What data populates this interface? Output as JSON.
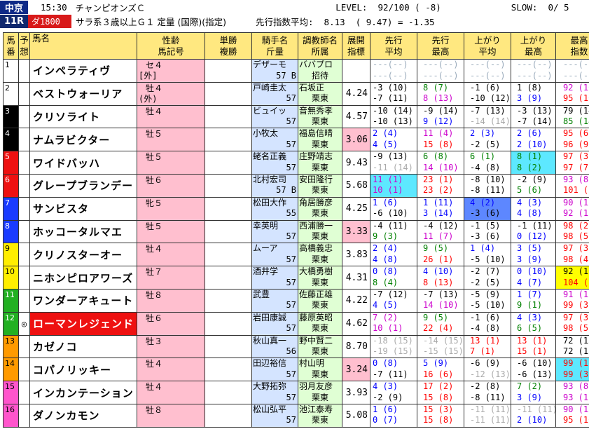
{
  "header": {
    "venue": "中京",
    "race_no": "11R",
    "time": "15:30",
    "race_name": "チャンピオンズＣ",
    "course": "ダ1800",
    "conditions": "サラ系３歳以上Ｇ１ 定量 (国際)(指定)",
    "level": "LEVEL:  92/100 ( -8)",
    "slow": "SLOW:  0/ 5",
    "pace_avg": "先行指数平均:  8.13  ( 9.47) = -1.35"
  },
  "columns": [
    "馬\n番",
    "予\n想",
    "馬名",
    "性齢\n馬記号",
    "単勝\n複勝",
    "騎手名\n斤量",
    "調教師名\n所属",
    "展開\n指標",
    "先行\n平均",
    "先行\n最高",
    "上がり\n平均",
    "上がり\n最高",
    "最高\n指数"
  ],
  "horses": [
    {
      "num": "1",
      "color": "white",
      "mark": "",
      "name": "インペラティヴ",
      "hl": false,
      "sex": "セ４",
      "sex2": "[外]",
      "jockey": "デザーモ",
      "weight": "57 B",
      "trainer": "ババプロ",
      "trainer2": "招待",
      "tenkai": "",
      "tenkai_hi": false,
      "s1": [
        "---(--)",
        "---(--)"
      ],
      "s1c": [
        "dash",
        "dash"
      ],
      "s1bg": "",
      "s2": [
        "---(--)",
        "---(--)"
      ],
      "s2c": [
        "dash",
        "dash"
      ],
      "a1": [
        "---(--)",
        "---(--)"
      ],
      "a1c": [
        "dash",
        "dash"
      ],
      "a1bg": "",
      "a2": [
        "---(--)",
        "---(--)"
      ],
      "a2c": [
        "dash",
        "dash"
      ],
      "a2bg": "",
      "mx": [
        "---(--)",
        "---(--)"
      ],
      "mxc": [
        "dash",
        "dash"
      ],
      "mxbg": ""
    },
    {
      "num": "2",
      "color": "white",
      "mark": "",
      "name": "ベストウォーリア",
      "hl": false,
      "sex": "牡４",
      "sex2": "(外)",
      "jockey": "戸崎圭太",
      "weight": "57",
      "trainer": "石坂正",
      "trainer2": "栗東",
      "tenkai": "4.24",
      "tenkai_hi": false,
      "s1": [
        "-3 (10)",
        "-7 (11)"
      ],
      "s1c": [
        "black",
        "black"
      ],
      "s1bg": "",
      "s2": [
        "8 (7)",
        "8 (13)"
      ],
      "s2c": [
        "green",
        "magenta"
      ],
      "a1": [
        "-1 (6)",
        "-10 (12)"
      ],
      "a1c": [
        "black",
        "black"
      ],
      "a1bg": "",
      "a2": [
        "1 (8)",
        "3 (9)"
      ],
      "a2c": [
        "black",
        "blue"
      ],
      "a2bg": "",
      "mx": [
        "92 (10)",
        "95 (10)"
      ],
      "mxc": [
        "magenta",
        "red"
      ],
      "mxbg": ""
    },
    {
      "num": "3",
      "color": "black",
      "mark": "",
      "name": "クリソライト",
      "hl": false,
      "sex": "牡４",
      "sex2": "",
      "jockey": "ビュイッ",
      "weight": "57",
      "trainer": "音無秀孝",
      "trainer2": "栗東",
      "tenkai": "4.57",
      "tenkai_hi": false,
      "s1": [
        "-10 (14)",
        "-10 (13)"
      ],
      "s1c": [
        "black",
        "black"
      ],
      "s1bg": "",
      "s2": [
        "-9 (14)",
        "9 (12)"
      ],
      "s2c": [
        "black",
        "blue"
      ],
      "a1": [
        "-7 (13)",
        "-14 (14)"
      ],
      "a1c": [
        "black",
        "gray"
      ],
      "a1bg": "",
      "a2": [
        "-3 (13)",
        "-7 (14)"
      ],
      "a2c": [
        "black",
        "black"
      ],
      "a2bg": "",
      "mx": [
        "79 (14)",
        "85 (14)"
      ],
      "mxc": [
        "black",
        "green"
      ],
      "mxbg": ""
    },
    {
      "num": "4",
      "color": "black",
      "mark": "",
      "name": "ナムラビクター",
      "hl": false,
      "sex": "牡５",
      "sex2": "",
      "jockey": "小牧太",
      "weight": "57",
      "trainer": "福島信晴",
      "trainer2": "栗東",
      "tenkai": "3.06",
      "tenkai_hi": true,
      "s1": [
        "2 (4)",
        "4 (5)"
      ],
      "s1c": [
        "blue",
        "blue"
      ],
      "s1bg": "",
      "s2": [
        "11 (4)",
        "15 (8)"
      ],
      "s2c": [
        "magenta",
        "red"
      ],
      "a1": [
        "2 (3)",
        "-2 (5)"
      ],
      "a1c": [
        "blue",
        "black"
      ],
      "a1bg": "",
      "a2": [
        "2 (6)",
        "2 (10)"
      ],
      "a2c": [
        "blue",
        "blue"
      ],
      "a2bg": "",
      "mx": [
        "95 (6)",
        "96 (9)"
      ],
      "mxc": [
        "red",
        "red"
      ],
      "mxbg": ""
    },
    {
      "num": "5",
      "color": "red",
      "mark": "",
      "name": "ワイドバッハ",
      "hl": false,
      "sex": "牡５",
      "sex2": "",
      "jockey": "蛯名正義",
      "weight": "57",
      "trainer": "庄野靖志",
      "trainer2": "栗東",
      "tenkai": "9.43",
      "tenkai_hi": false,
      "s1": [
        "-9 (13)",
        "-11 (14)"
      ],
      "s1c": [
        "black",
        "gray"
      ],
      "s1bg": "",
      "s2": [
        "6 (8)",
        "14 (10)"
      ],
      "s2c": [
        "green",
        "magenta"
      ],
      "a1": [
        "6 (1)",
        "-4 (8)"
      ],
      "a1c": [
        "green",
        "black"
      ],
      "a1bg": "",
      "a2": [
        "8 (1)",
        "8 (2)"
      ],
      "a2c": [
        "green",
        "green"
      ],
      "a2bg": "cyan",
      "mx": [
        "97 (3)",
        "97 (7)"
      ],
      "mxc": [
        "red",
        "red"
      ],
      "mxbg": ""
    },
    {
      "num": "6",
      "color": "red",
      "mark": "",
      "name": "グレープブランデー",
      "hl": false,
      "sex": "牡６",
      "sex2": "",
      "jockey": "北村宏司",
      "weight": "57 B",
      "trainer": "安田隆行",
      "trainer2": "栗東",
      "tenkai": "5.68",
      "tenkai_hi": false,
      "s1": [
        "11 (1)",
        "10 (1)"
      ],
      "s1c": [
        "magenta",
        "magenta"
      ],
      "s1bg": "cyan",
      "s2": [
        "23 (1)",
        "23 (2)"
      ],
      "s2c": [
        "red",
        "red"
      ],
      "a1": [
        "-8 (10)",
        "-8 (11)"
      ],
      "a1c": [
        "black",
        "black"
      ],
      "a1bg": "",
      "a2": [
        "-2 (9)",
        "5 (6)"
      ],
      "a2c": [
        "black",
        "green"
      ],
      "a2bg": "",
      "mx": [
        "93 (8)",
        "101 (2)"
      ],
      "mxc": [
        "magenta",
        "red"
      ],
      "mxbg": ""
    },
    {
      "num": "7",
      "color": "blue",
      "mark": "",
      "name": "サンビスタ",
      "hl": false,
      "sex": "牝５",
      "sex2": "",
      "jockey": "松田大作",
      "weight": "55",
      "trainer": "角居勝彦",
      "trainer2": "栗東",
      "tenkai": "4.25",
      "tenkai_hi": false,
      "s1": [
        "1 (6)",
        "-6 (10)"
      ],
      "s1c": [
        "blue",
        "black"
      ],
      "s1bg": "",
      "s2": [
        "1 (11)",
        "3 (14)"
      ],
      "s2c": [
        "blue",
        "blue"
      ],
      "a1": [
        "4 (2)",
        "-3 (6)"
      ],
      "a1c": [
        "blue",
        "black"
      ],
      "a1bg": "blue",
      "a2": [
        "4 (3)",
        "4 (8)"
      ],
      "a2c": [
        "blue",
        "blue"
      ],
      "a2bg": "",
      "mx": [
        "90 (12)",
        "92 (12)"
      ],
      "mxc": [
        "magenta",
        "magenta"
      ],
      "mxbg": ""
    },
    {
      "num": "8",
      "color": "blue",
      "mark": "",
      "name": "ホッコータルマエ",
      "hl": false,
      "sex": "牡５",
      "sex2": "",
      "jockey": "幸英明",
      "weight": "57",
      "trainer": "西浦勝一",
      "trainer2": "栗東",
      "tenkai": "3.33",
      "tenkai_hi": true,
      "s1": [
        "-4 (11)",
        "9 (3)"
      ],
      "s1c": [
        "black",
        "green"
      ],
      "s1bg": "",
      "s2": [
        "-4 (12)",
        "11 (7)"
      ],
      "s2c": [
        "black",
        "magenta"
      ],
      "a1": [
        "-1 (5)",
        "-3 (6)"
      ],
      "a1c": [
        "black",
        "black"
      ],
      "a1bg": "",
      "a2": [
        "-1 (11)",
        "0 (12)"
      ],
      "a2c": [
        "black",
        "blue"
      ],
      "a2bg": "",
      "mx": [
        "98 (2)",
        "98 (5)"
      ],
      "mxc": [
        "red",
        "red"
      ],
      "mxbg": ""
    },
    {
      "num": "9",
      "color": "yellow",
      "mark": "",
      "name": "クリノスターオー",
      "hl": false,
      "sex": "牡４",
      "sex2": "",
      "jockey": "ムーア",
      "weight": "57",
      "trainer": "高橋義忠",
      "trainer2": "栗東",
      "tenkai": "3.83",
      "tenkai_hi": false,
      "s1": [
        "2 (4)",
        "4 (8)"
      ],
      "s1c": [
        "blue",
        "blue"
      ],
      "s1bg": "",
      "s2": [
        "9 (5)",
        "26 (1)"
      ],
      "s2c": [
        "green",
        "red"
      ],
      "a1": [
        "1 (4)",
        "-5 (10)"
      ],
      "a1c": [
        "blue",
        "black"
      ],
      "a1bg": "",
      "a2": [
        "3 (5)",
        "3 (9)"
      ],
      "a2c": [
        "blue",
        "blue"
      ],
      "a2bg": "",
      "mx": [
        "97 (3)",
        "98 (4)"
      ],
      "mxc": [
        "red",
        "red"
      ],
      "mxbg": ""
    },
    {
      "num": "10",
      "color": "yellow",
      "mark": "",
      "name": "ニホンピロアワーズ",
      "hl": false,
      "sex": "牡７",
      "sex2": "",
      "jockey": "酒井学",
      "weight": "57",
      "trainer": "大橋勇樹",
      "trainer2": "栗東",
      "tenkai": "4.31",
      "tenkai_hi": false,
      "s1": [
        "0 (8)",
        "8 (4)"
      ],
      "s1c": [
        "blue",
        "green"
      ],
      "s1bg": "",
      "s2": [
        "4 (10)",
        "8 (13)"
      ],
      "s2c": [
        "blue",
        "red"
      ],
      "a1": [
        "-2 (7)",
        "-2 (5)"
      ],
      "a1c": [
        "black",
        "black"
      ],
      "a1bg": "",
      "a2": [
        "0 (10)",
        "4 (7)"
      ],
      "a2c": [
        "blue",
        "blue"
      ],
      "a2bg": "",
      "mx": [
        "92 (10)",
        "104 (1)"
      ],
      "mxc": [
        "black",
        "red"
      ],
      "mxbg": "yel"
    },
    {
      "num": "11",
      "color": "green",
      "mark": "",
      "name": "ワンダーアキュート",
      "hl": false,
      "sex": "牡８",
      "sex2": "",
      "jockey": "武豊",
      "weight": "57",
      "trainer": "佐藤正雄",
      "trainer2": "栗東",
      "tenkai": "4.22",
      "tenkai_hi": false,
      "s1": [
        "-7 (12)",
        "4 (5)"
      ],
      "s1c": [
        "black",
        "blue"
      ],
      "s1bg": "",
      "s2": [
        "-7 (13)",
        "14 (10)"
      ],
      "s2c": [
        "black",
        "magenta"
      ],
      "a1": [
        "-5 (9)",
        "-5 (10)"
      ],
      "a1c": [
        "black",
        "black"
      ],
      "a1bg": "",
      "a2": [
        "1 (7)",
        "9 (1)"
      ],
      "a2c": [
        "blue",
        "green"
      ],
      "a2bg": "",
      "mx": [
        "91 (11)",
        "99 (3)"
      ],
      "mxc": [
        "magenta",
        "red"
      ],
      "mxbg": ""
    },
    {
      "num": "12",
      "color": "green",
      "mark": "◎",
      "name": "ローマンレジェンド",
      "hl": true,
      "sex": "牡６",
      "sex2": "",
      "jockey": "岩田康誠",
      "weight": "57",
      "trainer": "藤原英昭",
      "trainer2": "栗東",
      "tenkai": "4.62",
      "tenkai_hi": false,
      "s1": [
        "7 (2)",
        "10 (1)"
      ],
      "s1c": [
        "magenta",
        "magenta"
      ],
      "s1bg": "",
      "s2": [
        "9 (5)",
        "22 (4)"
      ],
      "s2c": [
        "green",
        "red"
      ],
      "a1": [
        "-1 (6)",
        "-4 (8)"
      ],
      "a1c": [
        "black",
        "black"
      ],
      "a1bg": "",
      "a2": [
        "4 (3)",
        "6 (5)"
      ],
      "a2c": [
        "blue",
        "green"
      ],
      "a2bg": "",
      "mx": [
        "97 (3)",
        "98 (5)"
      ],
      "mxc": [
        "red",
        "red"
      ],
      "mxbg": ""
    },
    {
      "num": "13",
      "color": "orange",
      "mark": "",
      "name": "カゼノコ",
      "hl": false,
      "sex": "牡３",
      "sex2": "",
      "jockey": "秋山真一",
      "weight": "56",
      "trainer": "野中賢二",
      "trainer2": "栗東",
      "tenkai": "8.70",
      "tenkai_hi": false,
      "s1": [
        "-18 (15)",
        "-19 (15)"
      ],
      "s1c": [
        "gray",
        "gray"
      ],
      "s1bg": "",
      "s2": [
        "-14 (15)",
        "-15 (15)"
      ],
      "s2c": [
        "gray",
        "gray"
      ],
      "a1": [
        "13 (1)",
        "7 (1)"
      ],
      "a1c": [
        "red",
        "red"
      ],
      "a1bg": "",
      "a2": [
        "13 (1)",
        "15 (1)"
      ],
      "a2c": [
        "red",
        "red"
      ],
      "a2bg": "",
      "mx": [
        "72 (15)",
        "72 (15)"
      ],
      "mxc": [
        "black",
        "black"
      ],
      "mxbg": ""
    },
    {
      "num": "14",
      "color": "orange",
      "mark": "",
      "name": "コパノリッキー",
      "hl": false,
      "sex": "牡４",
      "sex2": "",
      "jockey": "田辺裕信",
      "weight": "57",
      "trainer": "村山明",
      "trainer2": "栗東",
      "tenkai": "3.24",
      "tenkai_hi": true,
      "s1": [
        "0 (8)",
        "-7 (11)"
      ],
      "s1c": [
        "blue",
        "black"
      ],
      "s1bg": "",
      "s2": [
        "5 (9)",
        "16 (6)"
      ],
      "s2c": [
        "blue",
        "red"
      ],
      "a1": [
        "-6 (9)",
        "-12 (13)"
      ],
      "a1c": [
        "black",
        "gray"
      ],
      "a1bg": "",
      "a2": [
        "-6 (10)",
        "-6 (13)"
      ],
      "a2c": [
        "black",
        "black"
      ],
      "a2bg": "",
      "mx": [
        "99 (1)",
        "99 (3)"
      ],
      "mxc": [
        "red",
        "red"
      ],
      "mxbg": "cyan"
    },
    {
      "num": "15",
      "color": "pink",
      "mark": "",
      "name": "インカンテーション",
      "hl": false,
      "sex": "牡４",
      "sex2": "",
      "jockey": "大野拓弥",
      "weight": "57",
      "trainer": "羽月友彦",
      "trainer2": "栗東",
      "tenkai": "3.93",
      "tenkai_hi": false,
      "s1": [
        "4 (3)",
        "-2 (9)"
      ],
      "s1c": [
        "blue",
        "black"
      ],
      "s1bg": "",
      "s2": [
        "17 (2)",
        "15 (8)"
      ],
      "s2c": [
        "red",
        "red"
      ],
      "a1": [
        "-2 (8)",
        "-8 (11)"
      ],
      "a1c": [
        "black",
        "black"
      ],
      "a1bg": "",
      "a2": [
        "7 (2)",
        "3 (9)"
      ],
      "a2c": [
        "green",
        "blue"
      ],
      "a2bg": "",
      "mx": [
        "93 (8)",
        "93 (11)"
      ],
      "mxc": [
        "magenta",
        "magenta"
      ],
      "mxbg": ""
    },
    {
      "num": "16",
      "color": "pink",
      "mark": "",
      "name": "ダノンカモン",
      "hl": false,
      "sex": "牡８",
      "sex2": "",
      "jockey": "松山弘平",
      "weight": "57",
      "trainer": "池江泰寿",
      "trainer2": "栗東",
      "tenkai": "5.08",
      "tenkai_hi": false,
      "s1": [
        "1 (6)",
        "0 (7)"
      ],
      "s1c": [
        "blue",
        "blue"
      ],
      "s1bg": "",
      "s2": [
        "15 (3)",
        "15 (8)"
      ],
      "s2c": [
        "red",
        "red"
      ],
      "a1": [
        "-11 (11)",
        "-11 (11)"
      ],
      "a1c": [
        "gray",
        "gray"
      ],
      "a1bg": "",
      "a2": [
        "-11 (11)",
        "2 (10)"
      ],
      "a2c": [
        "gray",
        "blue"
      ],
      "a2bg": "",
      "mx": [
        "90 (13)",
        "95 (10)"
      ],
      "mxc": [
        "magenta",
        "red"
      ],
      "mxbg": ""
    }
  ]
}
